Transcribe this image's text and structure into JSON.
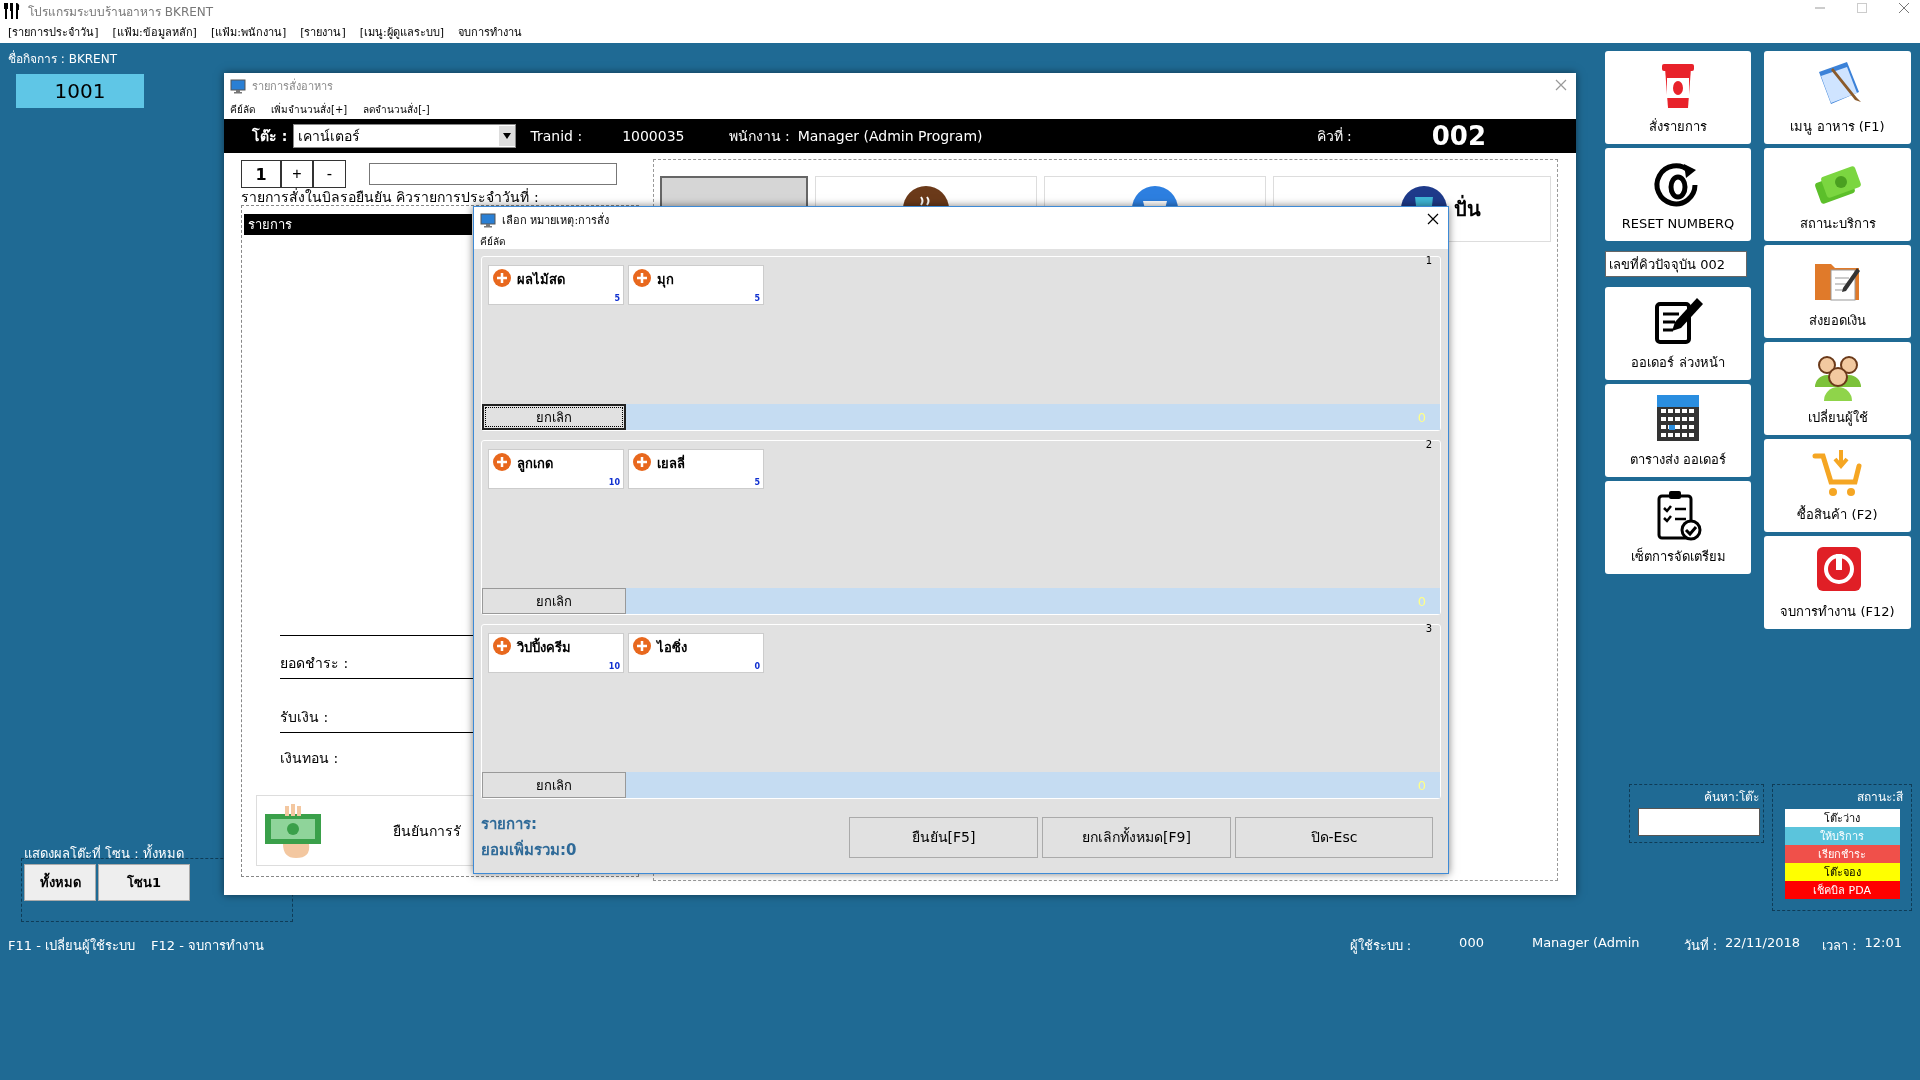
{
  "app": {
    "title": "โปรแกรมระบบร้านอาหาร  BKRENT",
    "menu": [
      "[รายการประจำวัน]",
      "[แฟ้ม:ข้อมูลหลัก]",
      "[แฟ้ม:พนักงาน]",
      "[รายงาน]",
      "[เมนู:ผู้ดูแลระบบ]",
      "จบการทำงาน"
    ]
  },
  "business": {
    "label": "ชื่อกิจการ :  BKRENT",
    "table_number": "1001"
  },
  "order_window": {
    "title": "รายการสั่งอาหาร",
    "menu": [
      "คีย์ลัด",
      "เพิ่มจำนวนสั่ง[+]",
      "ลดจำนวนสั่ง[-]"
    ],
    "table_label": "โต๊ะ :",
    "table_value": "เคาน์เตอร์",
    "tranid_label": "Tranid :",
    "tranid": "1000035",
    "staff_label": "พนักงาน :",
    "staff": "Manager (Admin Program)",
    "queue_label": "คิวที่ :",
    "queue": "002",
    "quantity": "1",
    "plus": "+",
    "minus": "-",
    "pending_label": "รายการสั่งในบิลรอยืนยัน คิวรายการประจำวันที่ :",
    "list_header": "รายการ",
    "totals": [
      "ยอดชำระ :",
      "รับเงิน :",
      "เงินทอน :"
    ],
    "confirm": "ยืนยันการรั",
    "categories": [
      {
        "kind": "plain",
        "disabled": true
      },
      {
        "kind": "coffee",
        "disabled": false
      },
      {
        "kind": "drink",
        "disabled": false
      },
      {
        "kind": "cup",
        "disabled": false,
        "label": "ปั่น"
      }
    ]
  },
  "dialog": {
    "title": "เลือก หมายเหตุ:การสั่ง",
    "menu": "คีย์ลัด",
    "groups": [
      {
        "number": "1",
        "items": [
          {
            "name": "ผลไม้สด",
            "count": "5"
          },
          {
            "name": "มุก",
            "count": "5"
          }
        ],
        "cancel": "ยกเลิก",
        "focused": true,
        "total": "0"
      },
      {
        "number": "2",
        "items": [
          {
            "name": "ลูกเกด",
            "count": "10"
          },
          {
            "name": "เยลลี่",
            "count": "5"
          }
        ],
        "cancel": "ยกเลิก",
        "focused": false,
        "total": "0"
      },
      {
        "number": "3",
        "items": [
          {
            "name": "วิปปิ้งครีม",
            "count": "10"
          },
          {
            "name": "ไอซิ่ง",
            "count": "0"
          }
        ],
        "cancel": "ยกเลิก",
        "focused": false,
        "total": "0"
      }
    ],
    "summary_label": "รายการ:",
    "summary_total": "ยอมเพิ่มรวม:0",
    "buttons": [
      "ยืนยัน[F5]",
      "ยกเลิกทั้งหมด[F9]",
      "ปิด-Esc"
    ]
  },
  "left_tools": [
    {
      "kind": "button",
      "label": "สั่งรายการ"
    },
    {
      "kind": "button",
      "label": "RESET NUMBERQ"
    },
    {
      "kind": "field",
      "value": "เลขที่คิวปัจจุบัน 002"
    },
    {
      "kind": "button",
      "label": "ออเดอร์ ล่วงหน้า"
    },
    {
      "kind": "button",
      "label": "ตารางส่ง ออเดอร์"
    },
    {
      "kind": "button",
      "label": "เซ็ตการจัดเตรียม"
    }
  ],
  "right_tools": [
    {
      "kind": "button",
      "label": "เมนู อาหาร  (F1)"
    },
    {
      "kind": "button",
      "label": "สถานะบริการ"
    },
    {
      "kind": "button",
      "label": "ส่งยอดเงิน"
    },
    {
      "kind": "button",
      "label": "เปลี่ยนผู้ใช้"
    },
    {
      "kind": "button",
      "label": "ซื้อสินค้า (F2)"
    },
    {
      "kind": "button",
      "label": "จบการทำงาน (F12)"
    }
  ],
  "zone": {
    "label": "แสดงผลโต๊ะที่  โซน : ทั้งหมด",
    "buttons": [
      "ทั้งหมด",
      "โซน1"
    ]
  },
  "search": {
    "label": "ค้นหา:โต๊ะ"
  },
  "status": {
    "label": "สถานะ:สี",
    "items": [
      {
        "name": "โต๊ะว่าง",
        "color": "#ffffff"
      },
      {
        "name": "ให้บริการ",
        "color": "#5bc4dc"
      },
      {
        "name": "เรียกชำระ",
        "color": "#f0504a"
      },
      {
        "name": "โต๊ะจอง",
        "color": "#ffff00"
      },
      {
        "name": "เช็คบิล PDA",
        "color": "#ff0000"
      }
    ]
  },
  "footer": {
    "shortcut_user": "F11 - เปลี่ยนผู้ใช้ระบบ",
    "shortcut_exit": "F12 - จบการทำงาน",
    "user_label": "ผู้ใช้ระบบ :",
    "user_id": "000",
    "user_name": "Manager (Admin",
    "date_label": "วันที่ :",
    "date": "22/11/2018",
    "time_label": "เวลา :",
    "time": "12:01"
  }
}
